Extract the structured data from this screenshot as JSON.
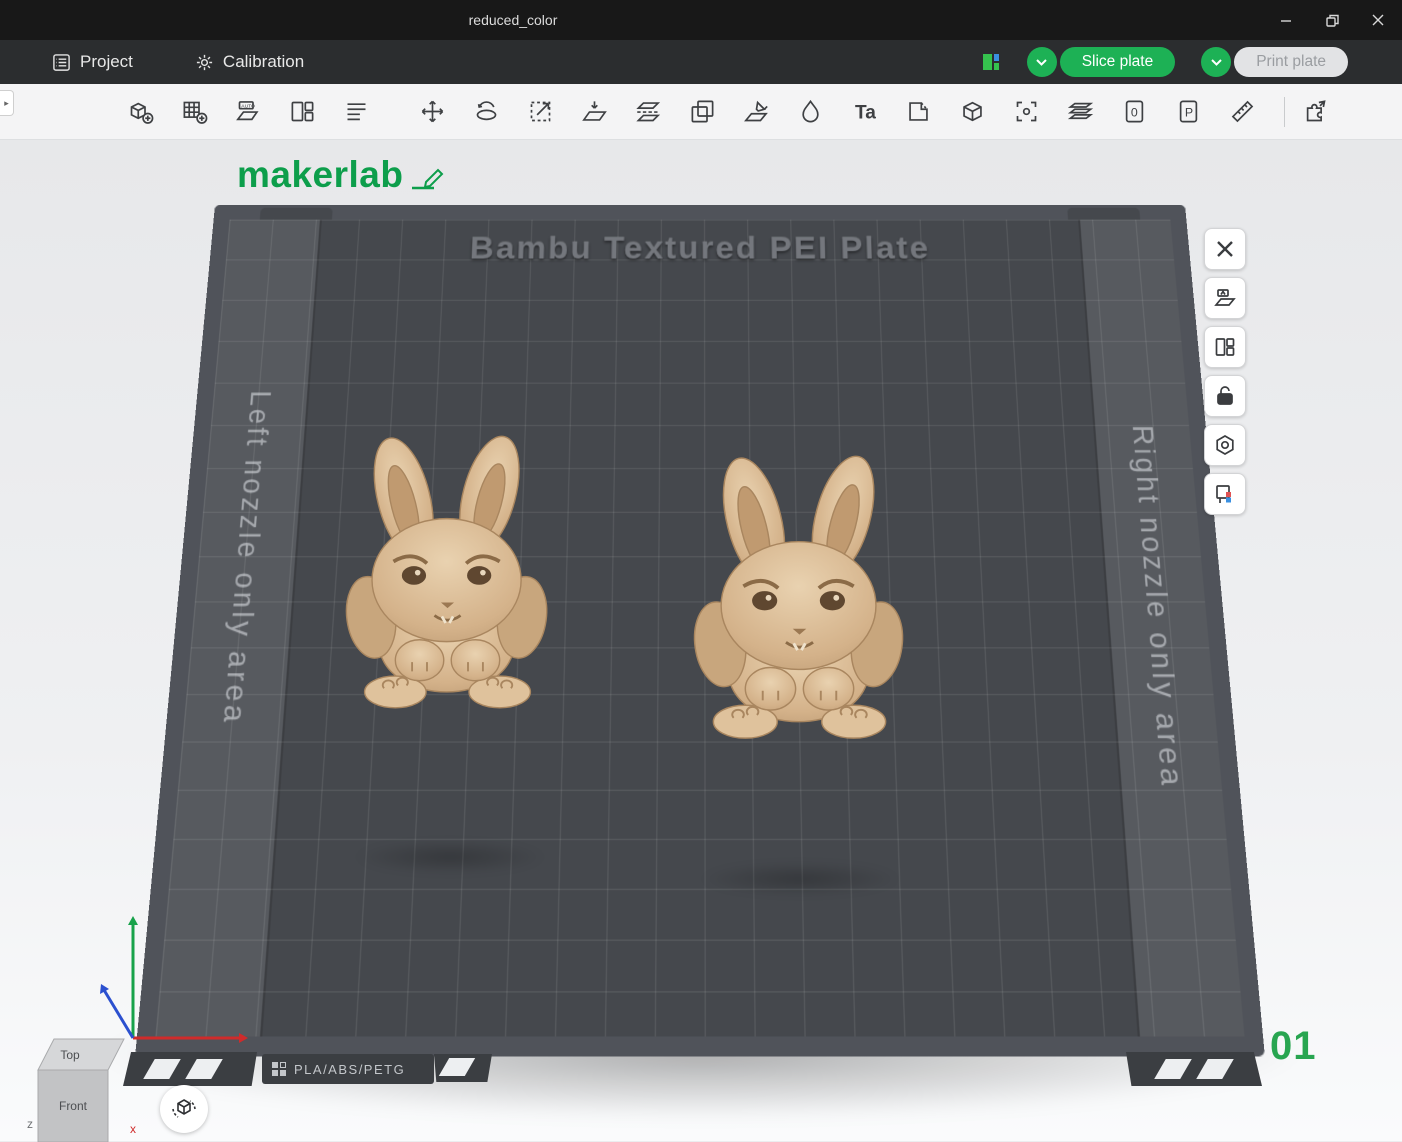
{
  "window": {
    "title": "reduced_color"
  },
  "menubar": {
    "project_label": "Project",
    "calibration_label": "Calibration",
    "slice_label": "Slice plate",
    "print_label": "Print plate"
  },
  "toolbar": {
    "icons": [
      "add-model",
      "add-plate",
      "auto-orient",
      "arrange",
      "objects-list",
      "move",
      "rotate",
      "scale",
      "place-on-face",
      "cut",
      "clone",
      "support-paint",
      "color-paint",
      "add-text",
      "seam-paint",
      "add-primitive",
      "select-frame",
      "variable-layer-height",
      "process-0",
      "process-p",
      "measure",
      "assembly-view"
    ],
    "glyphs": {
      "auto": "AUTO",
      "text_tool": "Ta",
      "process0": "0",
      "processP": "P"
    }
  },
  "side_toolbar": {
    "icons": [
      "delete-all",
      "auto-orient-plate",
      "arrange-plate",
      "lock-plate",
      "plate-settings",
      "color-plate"
    ]
  },
  "viewport": {
    "logo": "makerlab",
    "plate": {
      "title": "Bambu Textured PEI Plate",
      "left_label": "Left nozzle only area",
      "right_label": "Right nozzle only area",
      "material": "PLA/ABS/PETG",
      "number": "01"
    },
    "nav_cube": {
      "top_label": "Top",
      "front_label": "Front"
    },
    "axes": {
      "x_label": "x",
      "z_label": "z"
    },
    "models": [
      {
        "name": "bunny-left"
      },
      {
        "name": "bunny-right"
      }
    ]
  },
  "colors": {
    "accent_green": "#1db155",
    "logo_green": "#0d9e4b",
    "plate_dark": "#45484d",
    "plate_rim": "#50535a",
    "bunny_tan": "#d4b28a"
  }
}
